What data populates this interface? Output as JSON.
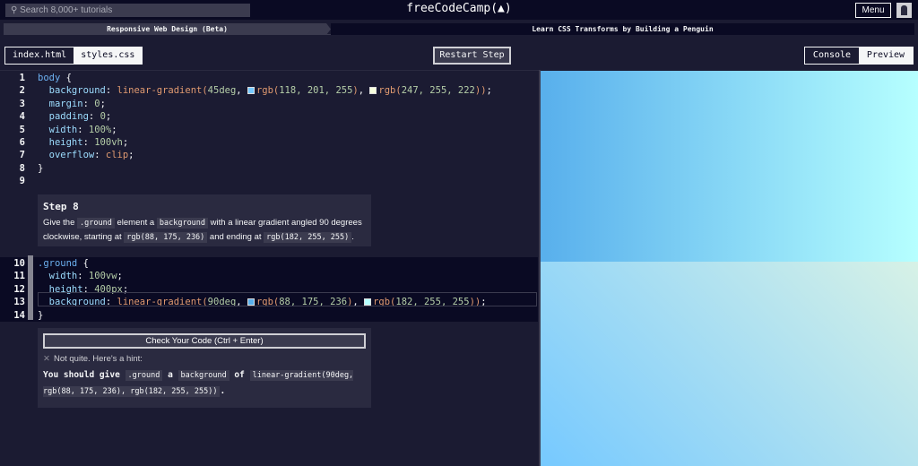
{
  "nav": {
    "search_placeholder": "Search 8,000+ tutorials",
    "logo": "freeCodeCamp(🔥)",
    "logo_text": "freeCodeCamp(",
    "logo_close": ")",
    "menu": "Menu"
  },
  "breadcrumbs": {
    "superblock": "Responsive Web Design (Beta)",
    "block": "Learn CSS Transforms by Building a Penguin"
  },
  "file_tabs": [
    "index.html",
    "styles.css"
  ],
  "restart": "Restart Step",
  "preview_tabs": [
    "Console",
    "Preview"
  ],
  "code_lines": [
    {
      "n": "1",
      "tokens": [
        [
          "sel",
          "body "
        ],
        [
          "punc",
          "{"
        ]
      ]
    },
    {
      "n": "2",
      "tokens": [
        [
          "prop",
          "  background"
        ],
        [
          "punc",
          ": "
        ],
        [
          "str",
          "linear-gradient("
        ],
        [
          "num",
          "45deg"
        ],
        [
          "punc",
          ", "
        ],
        [
          "sw",
          "#76c9ff"
        ],
        [
          "str",
          "rgb("
        ],
        [
          "num",
          "118, 201, 255"
        ],
        [
          "str",
          ")"
        ],
        [
          "punc",
          ", "
        ],
        [
          "sw",
          "#f7ffde"
        ],
        [
          "str",
          "rgb("
        ],
        [
          "num",
          "247, 255, 222"
        ],
        [
          "str",
          "))"
        ],
        [
          "punc",
          ";"
        ]
      ]
    },
    {
      "n": "3",
      "tokens": [
        [
          "prop",
          "  margin"
        ],
        [
          "punc",
          ": "
        ],
        [
          "num",
          "0"
        ],
        [
          "punc",
          ";"
        ]
      ]
    },
    {
      "n": "4",
      "tokens": [
        [
          "prop",
          "  padding"
        ],
        [
          "punc",
          ": "
        ],
        [
          "num",
          "0"
        ],
        [
          "punc",
          ";"
        ]
      ]
    },
    {
      "n": "5",
      "tokens": [
        [
          "prop",
          "  width"
        ],
        [
          "punc",
          ": "
        ],
        [
          "num",
          "100%"
        ],
        [
          "punc",
          ";"
        ]
      ]
    },
    {
      "n": "6",
      "tokens": [
        [
          "prop",
          "  height"
        ],
        [
          "punc",
          ": "
        ],
        [
          "num",
          "100vh"
        ],
        [
          "punc",
          ";"
        ]
      ]
    },
    {
      "n": "7",
      "tokens": [
        [
          "prop",
          "  overflow"
        ],
        [
          "punc",
          ": "
        ],
        [
          "str",
          "clip"
        ],
        [
          "punc",
          ";"
        ]
      ]
    },
    {
      "n": "8",
      "tokens": [
        [
          "punc",
          "}"
        ]
      ]
    },
    {
      "n": "9",
      "tokens": []
    },
    {
      "n": "10",
      "tokens": [
        [
          "sel",
          ".ground "
        ],
        [
          "punc",
          "{"
        ]
      ]
    },
    {
      "n": "11",
      "tokens": [
        [
          "prop",
          "  width"
        ],
        [
          "punc",
          ": "
        ],
        [
          "num",
          "100vw"
        ],
        [
          "punc",
          ";"
        ]
      ]
    },
    {
      "n": "12",
      "tokens": [
        [
          "prop",
          "  height"
        ],
        [
          "punc",
          ": "
        ],
        [
          "num",
          "400px"
        ],
        [
          "punc",
          ";"
        ]
      ]
    },
    {
      "n": "13",
      "tokens": [
        [
          "prop",
          "  background"
        ],
        [
          "punc",
          ": "
        ],
        [
          "str",
          "linear-gradient("
        ],
        [
          "num",
          "90deg"
        ],
        [
          "punc",
          ", "
        ],
        [
          "sw",
          "#58afec"
        ],
        [
          "str",
          "rgb("
        ],
        [
          "num",
          "88, 175, 236"
        ],
        [
          "str",
          ")"
        ],
        [
          "punc",
          ", "
        ],
        [
          "sw",
          "#b6ffff"
        ],
        [
          "str",
          "rgb("
        ],
        [
          "num",
          "182, 255, 255"
        ],
        [
          "str",
          "))"
        ],
        [
          "punc",
          ";"
        ]
      ]
    },
    {
      "n": "14",
      "tokens": [
        [
          "punc",
          "}"
        ]
      ]
    }
  ],
  "step": {
    "title": "Step 8",
    "t1": "Give the ",
    "c1": ".ground",
    "t2": " element a ",
    "c2": "background",
    "t3": " with a linear gradient angled 90 degrees clockwise, starting at ",
    "c3": "rgb(88, 175, 236)",
    "t4": " and ending at ",
    "c4": "rgb(182, 255, 255)",
    "t5": "."
  },
  "check": {
    "button": "Check Your Code (Ctrl + Enter)",
    "status": "Not quite. Here's a hint:",
    "h1": "You should give ",
    "c1": ".ground",
    "h2": " a ",
    "c2": "background",
    "h3": " of ",
    "c3": "linear-gradient(90deg, rgb(88, 175, 236), rgb(182, 255, 255))",
    "h4": "."
  },
  "colors": {
    "ground_start": "#58afec",
    "ground_end": "#b6ffff",
    "body_start": "#76c9ff",
    "body_end": "#f7ffde"
  }
}
